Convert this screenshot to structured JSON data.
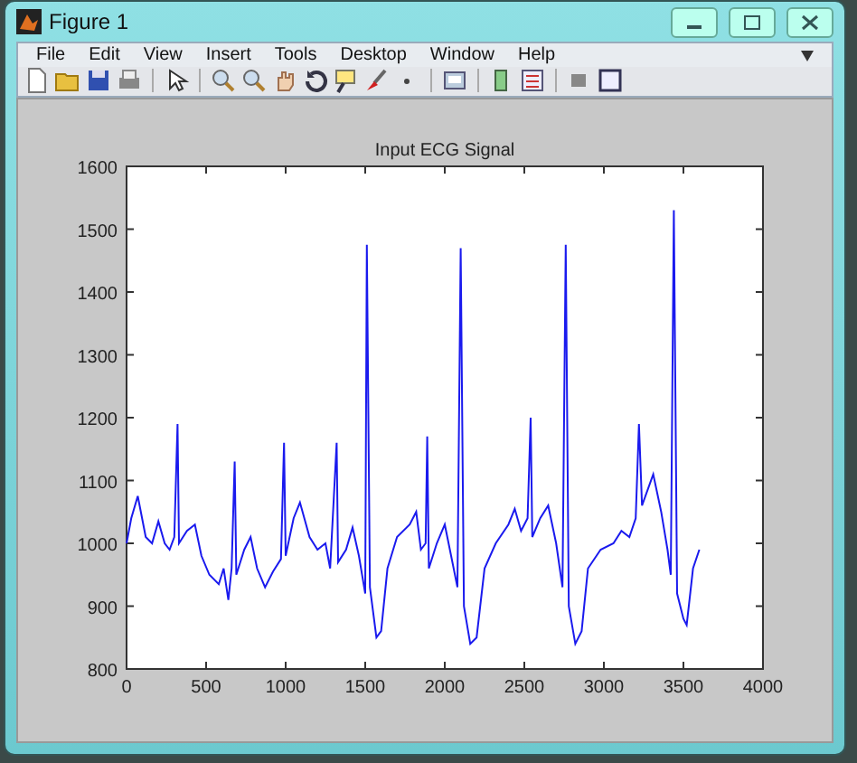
{
  "window": {
    "title": "Figure 1"
  },
  "menu": [
    "File",
    "Edit",
    "View",
    "Insert",
    "Tools",
    "Desktop",
    "Window",
    "Help"
  ],
  "figure": {
    "chart_data": {
      "type": "line",
      "title": "Input ECG Signal",
      "x": [
        0,
        30,
        70,
        120,
        160,
        200,
        240,
        270,
        300,
        320,
        330,
        380,
        430,
        470,
        520,
        580,
        610,
        640,
        660,
        680,
        690,
        740,
        780,
        820,
        870,
        920,
        970,
        990,
        1000,
        1050,
        1090,
        1150,
        1200,
        1250,
        1280,
        1320,
        1330,
        1380,
        1420,
        1460,
        1500,
        1510,
        1530,
        1570,
        1600,
        1640,
        1700,
        1780,
        1820,
        1850,
        1880,
        1890,
        1900,
        1950,
        2000,
        2040,
        2080,
        2100,
        2120,
        2160,
        2200,
        2250,
        2320,
        2400,
        2440,
        2480,
        2520,
        2540,
        2550,
        2600,
        2650,
        2700,
        2740,
        2760,
        2780,
        2820,
        2860,
        2900,
        2980,
        3060,
        3110,
        3160,
        3200,
        3220,
        3240,
        3310,
        3360,
        3400,
        3420,
        3440,
        3460,
        3500,
        3520,
        3560,
        3600
      ],
      "series": [
        {
          "color": "#1a1aee",
          "values": [
            1000,
            1040,
            1075,
            1010,
            1000,
            1035,
            1000,
            990,
            1010,
            1190,
            1000,
            1020,
            1030,
            980,
            950,
            935,
            960,
            910,
            960,
            1130,
            950,
            990,
            1010,
            960,
            930,
            955,
            975,
            1160,
            980,
            1040,
            1065,
            1010,
            990,
            1000,
            960,
            1160,
            970,
            990,
            1025,
            980,
            920,
            1475,
            930,
            850,
            860,
            960,
            1010,
            1030,
            1050,
            990,
            1000,
            1170,
            960,
            1000,
            1030,
            980,
            930,
            1470,
            900,
            840,
            850,
            960,
            1000,
            1030,
            1055,
            1020,
            1040,
            1200,
            1010,
            1040,
            1060,
            1000,
            930,
            1475,
            900,
            840,
            860,
            960,
            990,
            1000,
            1020,
            1010,
            1040,
            1190,
            1060,
            1110,
            1050,
            990,
            950,
            1530,
            920,
            880,
            870,
            960,
            990
          ]
        }
      ],
      "xlim": [
        0,
        4000
      ],
      "ylim": [
        800,
        1600
      ],
      "xticks": [
        0,
        500,
        1000,
        1500,
        2000,
        2500,
        3000,
        3500,
        4000
      ],
      "yticks": [
        800,
        900,
        1000,
        1100,
        1200,
        1300,
        1400,
        1500,
        1600
      ]
    }
  }
}
